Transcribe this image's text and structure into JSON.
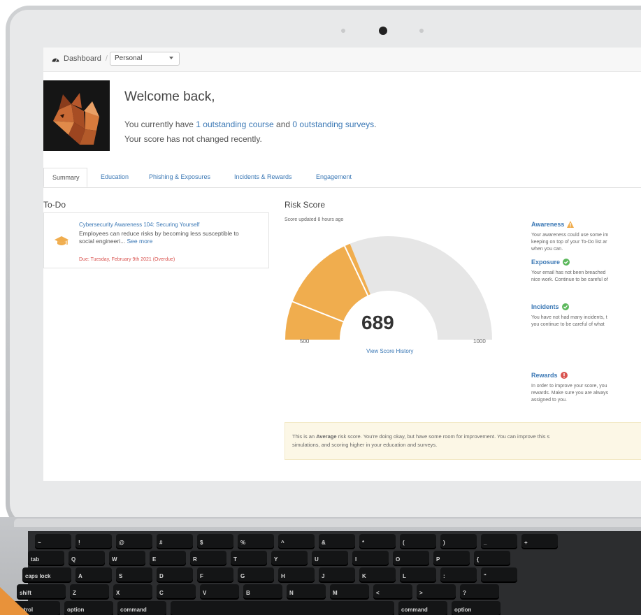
{
  "header": {
    "dashboard_label": "Dashboard",
    "scope_select_value": "Personal"
  },
  "welcome": {
    "title": "Welcome back,",
    "line1_prefix": "You currently have ",
    "line1_course_link": "1 outstanding course",
    "line1_mid": " and ",
    "line1_survey_link": "0 outstanding surveys",
    "line1_suffix": ".",
    "line2": "Your score has not changed recently."
  },
  "tabs": [
    "Summary",
    "Education",
    "Phishing & Exposures",
    "Incidents & Rewards",
    "Engagement"
  ],
  "todo": {
    "title": "To-Do",
    "item": {
      "course": "Cybersecurity Awareness 104: Securing Yourself",
      "desc_line1": "Employees can reduce risks by becoming less susceptible to",
      "desc_line2_prefix": "social engineeri... ",
      "see_more": "See more",
      "due": "Due: Tuesday, February 9th 2021 (Overdue)"
    }
  },
  "risk": {
    "title": "Risk Score",
    "updated": "Score updated 8 hours ago",
    "score": "689",
    "min_label": "500",
    "max_label": "1000",
    "history_link": "View Score History",
    "gauge": {
      "min": 500,
      "max": 1000,
      "value": 689,
      "fill_color": "#f0ad4e",
      "track_color": "#e6e6e6"
    }
  },
  "factors": [
    {
      "name": "Awareness",
      "status_icon": "warning-icon",
      "line1": "Your awareness could use some im",
      "line2": "keeping on top of your To-Do list ar",
      "line3": "when you can."
    },
    {
      "name": "Exposure",
      "status_icon": "check-icon",
      "line1": "Your email has not been breached",
      "line2": "nice work. Continue to be careful of",
      "line3": ""
    },
    {
      "name": "Incidents",
      "status_icon": "check-icon",
      "line1": "You have not had many incidents, t",
      "line2": "you continue to be careful of what",
      "line3": ""
    },
    {
      "name": "Rewards",
      "status_icon": "alert-icon",
      "line1": "In order to improve your score, you",
      "line2": "rewards. Make sure you are always",
      "line3": "assigned to you."
    }
  ],
  "banner": {
    "prefix": "This is an ",
    "bold": "Average",
    "rest_line1": " risk score. You're doing okay, but have some room for improvement. You can improve this s",
    "line2": "simulations, and scoring higher in your education and surveys."
  },
  "keyboard": {
    "row_bottom": [
      "control",
      "option",
      "command",
      "",
      "command",
      "option"
    ],
    "row_shift": [
      "shift",
      "Z",
      "X",
      "C",
      "V",
      "B",
      "N",
      "M",
      "<",
      ">",
      "?"
    ],
    "row_caps": [
      "caps lock",
      "A",
      "S",
      "D",
      "F",
      "G",
      "H",
      "J",
      "K",
      "L",
      ":",
      "\""
    ],
    "row_tab": [
      "tab",
      "Q",
      "W",
      "E",
      "R",
      "T",
      "Y",
      "U",
      "I",
      "O",
      "P",
      "{"
    ],
    "row_num": [
      "~",
      "!",
      "@",
      "#",
      "$",
      "%",
      "^",
      "&",
      "*",
      "(",
      ")",
      "_",
      "+"
    ]
  },
  "colors": {
    "link": "#3b78b5",
    "accent": "#f0ad4e",
    "ok": "#5cb85c",
    "danger": "#d9534f"
  }
}
